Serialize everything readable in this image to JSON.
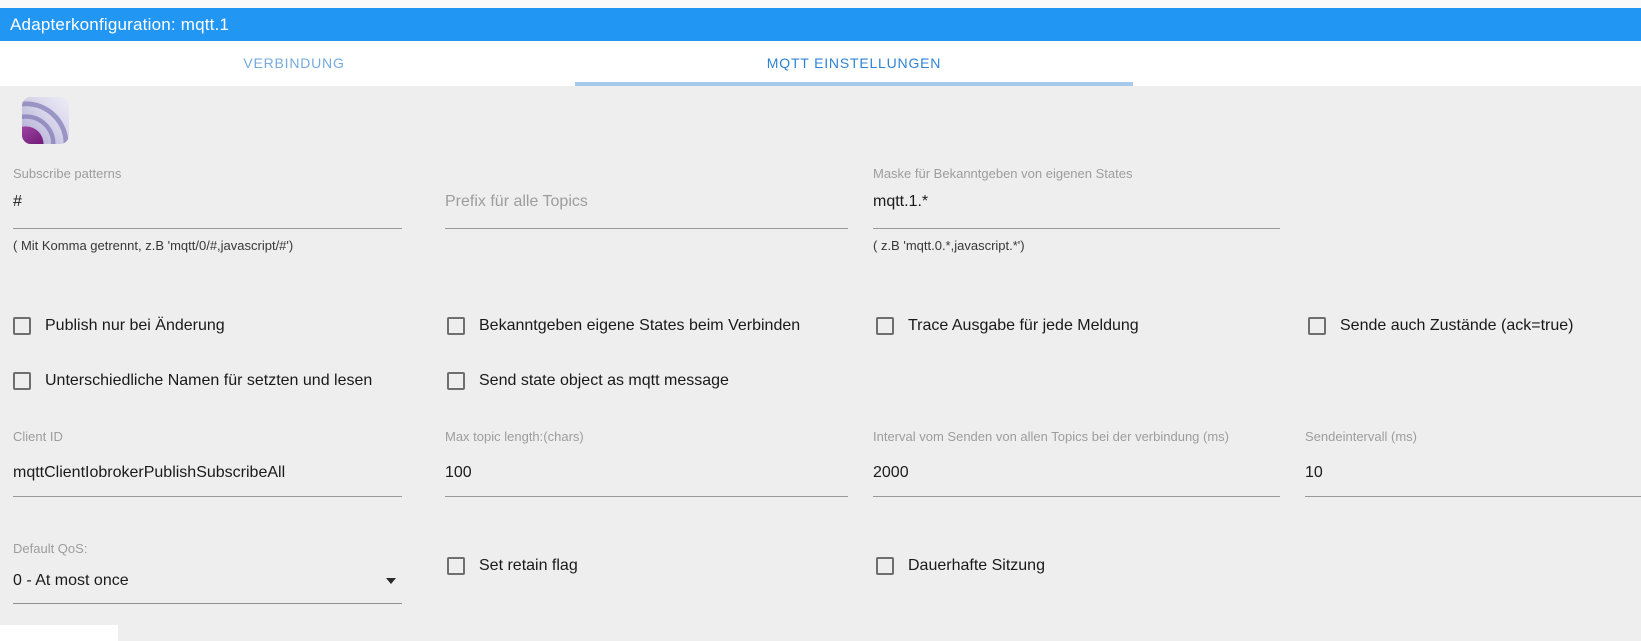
{
  "window": {
    "title": "Adapterkonfiguration: mqtt.1"
  },
  "tabs": {
    "verbindung": "VERBINDUNG",
    "mqtt_einstellungen": "MQTT EINSTELLUNGEN"
  },
  "fields": {
    "subscribe_patterns": {
      "label": "Subscribe patterns",
      "value": "#",
      "help": "( Mit Komma getrennt, z.B 'mqtt/0/#,javascript/#')"
    },
    "prefix": {
      "placeholder": "Prefix für alle Topics",
      "value": ""
    },
    "announce_mask": {
      "label": "Maske für Bekanntgeben von eigenen States",
      "value": "mqtt.1.*",
      "help": "( z.B 'mqtt.0.*,javascript.*')"
    },
    "client_id": {
      "label": "Client ID",
      "value": "mqttClientIobrokerPublishSubscribeAll"
    },
    "max_topic_length": {
      "label": "Max topic length:(chars)",
      "value": "100"
    },
    "interval_all_topics": {
      "label": "Interval vom Senden von allen Topics bei der verbindung (ms)",
      "value": "2000"
    },
    "send_interval": {
      "label": "Sendeintervall (ms)",
      "value": "10"
    },
    "default_qos": {
      "label": "Default QoS:",
      "value": "0 - At most once"
    }
  },
  "checkboxes": {
    "publish_on_change": "Publish nur bei Änderung",
    "announce_on_connect": "Bekanntgeben eigene States beim Verbinden",
    "trace_output": "Trace Ausgabe für jede Meldung",
    "send_ack_states": "Sende auch Zustände (ack=true)",
    "different_names": "Unterschiedliche Namen für setzten und lesen",
    "send_state_object": "Send state object as mqtt message",
    "set_retain_flag": "Set retain flag",
    "persistent_session": "Dauerhafte Sitzung"
  },
  "colors": {
    "header_blue": "#2196f3",
    "tab_active_text": "#2f83d7",
    "tab_inactive_text": "#74aade",
    "tab_indicator": "#a6c8ea",
    "background": "#eeeeee",
    "icon_purple": "#7c1a80"
  }
}
